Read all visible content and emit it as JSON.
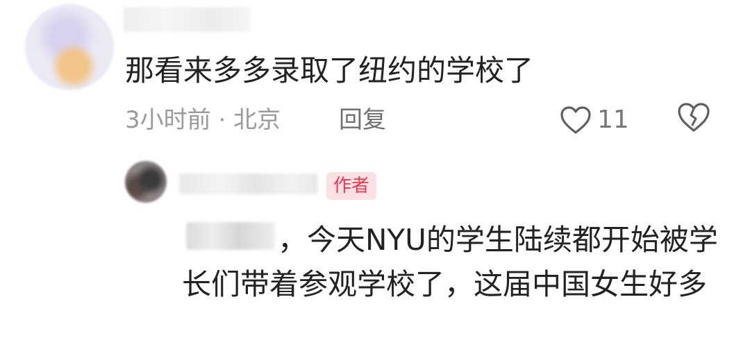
{
  "comment": {
    "text": "那看来多多录取了纽约的学校了",
    "time_location": "3小时前 · 北京",
    "reply_label": "回复",
    "like_count": "11",
    "icons": {
      "like": "heart-outline-icon",
      "dislike": "broken-heart-icon"
    }
  },
  "reply": {
    "author_badge": "作者",
    "text": "，今天NYU的学生陆续都开始被学长们带着参观学校了，这届中国女生好多"
  },
  "colors": {
    "text_primary": "#222222",
    "text_meta": "#9a9a9a",
    "badge_text": "#f0384f",
    "badge_bg": "#fbe1e4"
  }
}
